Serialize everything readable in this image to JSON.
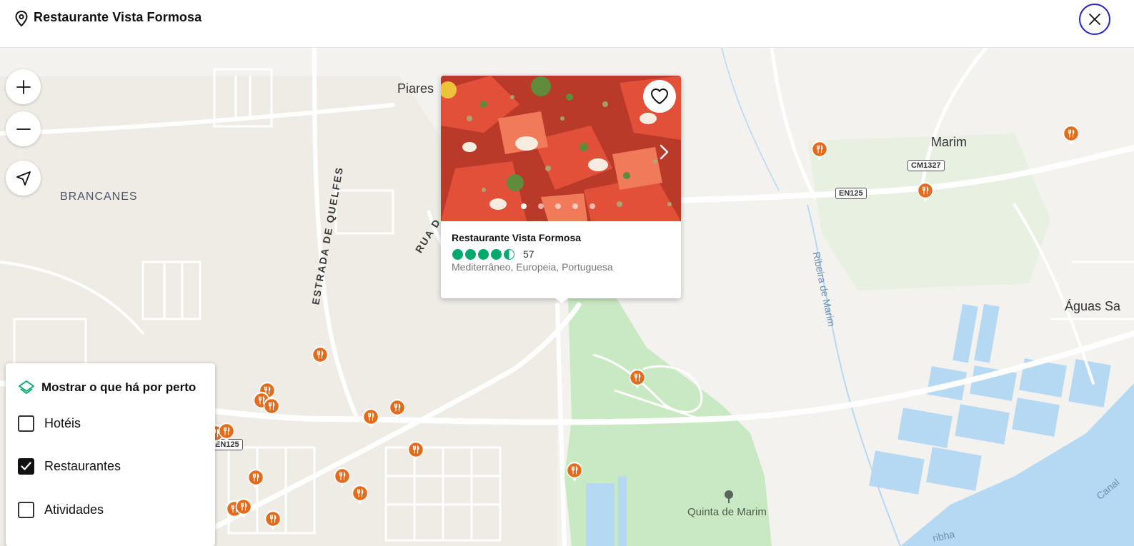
{
  "header": {
    "title": "Restaurante Vista Formosa"
  },
  "map": {
    "labels": {
      "piares": "Piares",
      "brancanes": "BRANCANES",
      "marim": "Marim",
      "aguas": "Águas Sa",
      "quinta": "Quinta de Marim",
      "estrada": "ESTRADA DE QUELFES",
      "rua": "RUA D",
      "ribeira": "Ribeira de Marim",
      "canal": "Canal",
      "ribeira_bottom": "ribha"
    },
    "road_badges": {
      "cm1327": "CM1327",
      "en125_right": "EN125",
      "en125_left": "EN125"
    }
  },
  "popup": {
    "name": "Restaurante Vista Formosa",
    "rating": 4.5,
    "review_count": "57",
    "cuisine": "Mediterrâneo, Europeia, Portuguesa",
    "photo_count": 5,
    "active_photo": 1
  },
  "nearby": {
    "title": "Mostrar o que há por perto",
    "options": [
      {
        "label": "Hotéis",
        "checked": false
      },
      {
        "label": "Restaurantes",
        "checked": true
      },
      {
        "label": "Atividades",
        "checked": false
      }
    ]
  },
  "colors": {
    "marker": "#e36c1c",
    "rating": "#00aa6c",
    "close_border": "#2323c8",
    "park": "#c9e9c2",
    "water": "#b5d8f3",
    "road": "#ffffff"
  },
  "icons": {
    "pin": "map-pin-icon",
    "close": "close-icon",
    "zoom_in": "plus-icon",
    "zoom_out": "minus-icon",
    "locate": "navigation-arrow-icon",
    "favorite": "heart-icon",
    "next": "chevron-right-icon",
    "layers": "layers-icon",
    "restaurant": "fork-knife-icon",
    "park": "tree-icon"
  }
}
